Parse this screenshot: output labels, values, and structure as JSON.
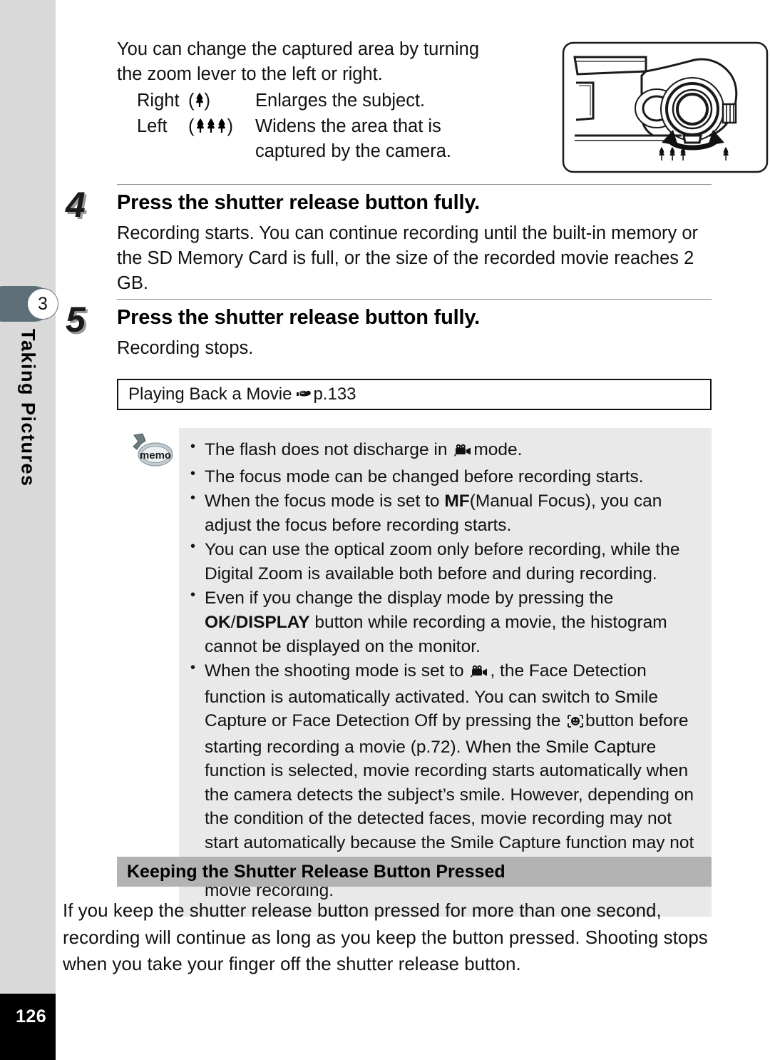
{
  "sidebar": {
    "chapter_number": "3",
    "chapter_title": "Taking Pictures",
    "page_number": "126"
  },
  "intro": {
    "paragraph": "You can change the captured area by turning the zoom lever to the left or right.",
    "rows": [
      {
        "direction": "Right",
        "symbol": "tele-tree-icon",
        "description": "Enlarges the subject."
      },
      {
        "direction": "Left",
        "symbol": "wide-tree-icon",
        "description": "Widens the area that is captured by the camera."
      }
    ]
  },
  "illustration": {
    "name": "camera-top-zoom-lever-diagram",
    "wide_label": "wide-tree-icon",
    "tele_label": "tele-tree-icon"
  },
  "steps": [
    {
      "number": "4",
      "heading": "Press the shutter release button fully.",
      "body": "Recording starts. You can continue recording until the built-in memory or the SD Memory Card is full, or the size of the recorded movie reaches 2 GB."
    },
    {
      "number": "5",
      "heading": "Press the shutter release button fully.",
      "body": "Recording stops."
    }
  ],
  "reference_box": {
    "label": "Playing Back a Movie",
    "icon": "pointing-hand-icon",
    "page_ref": "p.133"
  },
  "memo": {
    "icon_label": "memo",
    "bullets": [
      "The flash does not discharge in   mode.",
      "The focus mode can be changed before recording starts.",
      "When the focus mode is set to MF (Manual Focus), you can adjust the focus before recording starts.",
      "You can use the optical zoom only before recording, while the Digital Zoom is available both before and during recording.",
      "Even if you change the display mode by pressing the OK/DISPLAY button while recording a movie, the histogram cannot be displayed on the monitor.",
      "When the shooting mode is set to   , the Face Detection function is automatically activated. You can switch to Smile Capture or Face Detection Off by pressing the   button before starting recording a movie (p.72). When the Smile Capture function is selected, movie recording starts automatically when the camera detects the subject’s smile. However, depending on the condition of the detected faces, movie recording may not start automatically because the Smile Capture function may not work. If this happens, press the shutter release button to start movie recording."
    ],
    "bullet_1_pre": "The flash does not discharge in",
    "bullet_1_post": "mode.",
    "bullet_3_pre": "When the focus mode is set to",
    "bullet_3_mf": "MF",
    "bullet_3_post": "(Manual Focus), you can adjust the focus before recording starts.",
    "bullet_5_pre": "Even if you change the display mode by pressing the",
    "bullet_5_ok": "OK",
    "bullet_5_slash": "/",
    "bullet_5_display": "DISPLAY",
    "bullet_5_post": "button while recording a movie, the histogram cannot be displayed on the monitor.",
    "bullet_6_a": "When the shooting mode is set to",
    "bullet_6_b": ", the Face Detection function is automatically activated. You can switch to Smile Capture or Face Detection Off by pressing the",
    "bullet_6_c": "button before starting recording a movie (p.72). When the Smile Capture function is selected, movie recording starts automatically when the camera detects the subject’s smile. However, depending on the condition of the detected faces, movie recording may not start automatically because the Smile Capture function may not work. If this happens, press the shutter release button to start movie recording."
  },
  "subsection": {
    "heading": "Keeping the Shutter Release Button Pressed",
    "body": "If you keep the shutter release button pressed for more than one second, recording will continue as long as you keep the button pressed. Shooting stops when you take your finger off the shutter release button."
  },
  "colors": {
    "chapter_tab": "#5d7077",
    "sidebar_bg": "#d9d9d9",
    "memo_bg": "#e9e9e9",
    "subhead_bg": "#b3b3b3",
    "page_block_bg": "#000000"
  }
}
